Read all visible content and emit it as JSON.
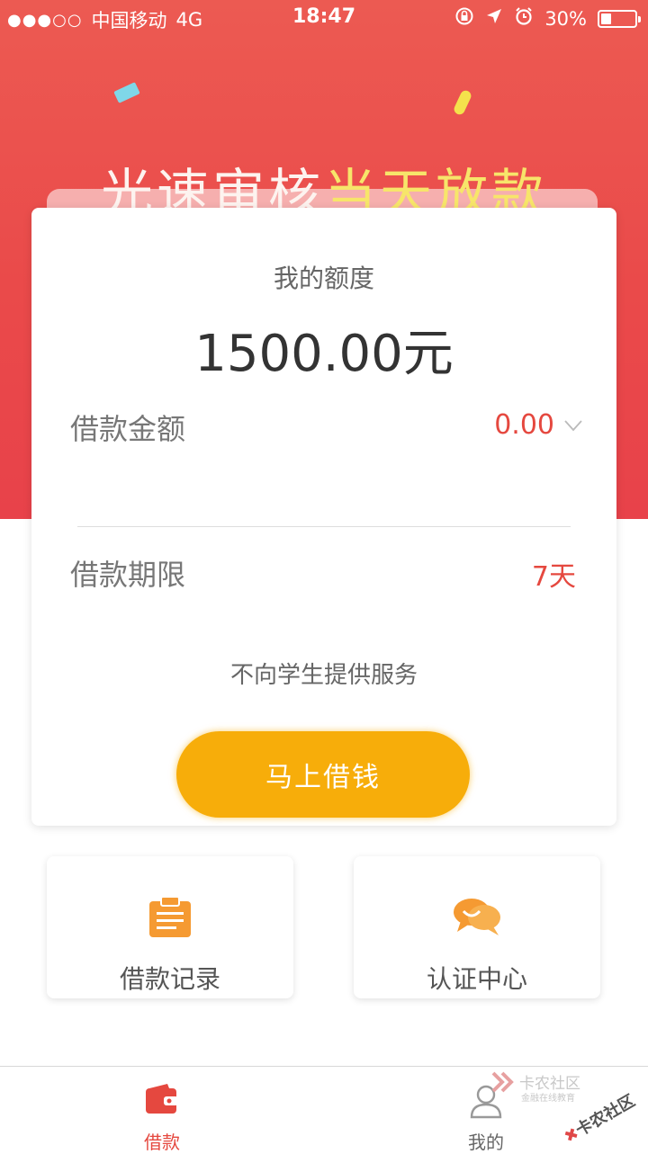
{
  "status_bar": {
    "signal": "●●●○○",
    "carrier": "中国移动",
    "network": "4G",
    "time": "18:47",
    "battery_percent": "30%",
    "battery_level": 0.3
  },
  "hero": {
    "slogan_part1": "光速审核",
    "slogan_part2": "当天放款"
  },
  "card": {
    "title": "我的额度",
    "amount": "1500.00元",
    "loan_amount_label": "借款金额",
    "loan_amount_value": "0.00",
    "loan_term_label": "借款期限",
    "loan_term_value": "7天",
    "notice": "不向学生提供服务",
    "cta": "马上借钱"
  },
  "tiles": [
    {
      "label": "借款记录",
      "icon": "clipboard-icon"
    },
    {
      "label": "认证中心",
      "icon": "chat-icon"
    }
  ],
  "tabbar": {
    "items": [
      {
        "label": "借款",
        "icon": "wallet-icon",
        "active": true
      },
      {
        "label": "我的",
        "icon": "user-icon",
        "active": false
      }
    ]
  },
  "watermark": {
    "name": "卡农社区",
    "subtitle": "金融在线教育"
  },
  "colors": {
    "accent_red": "#e5483f",
    "cta_yellow": "#f7ad0a",
    "icon_orange": "#f59a32"
  }
}
